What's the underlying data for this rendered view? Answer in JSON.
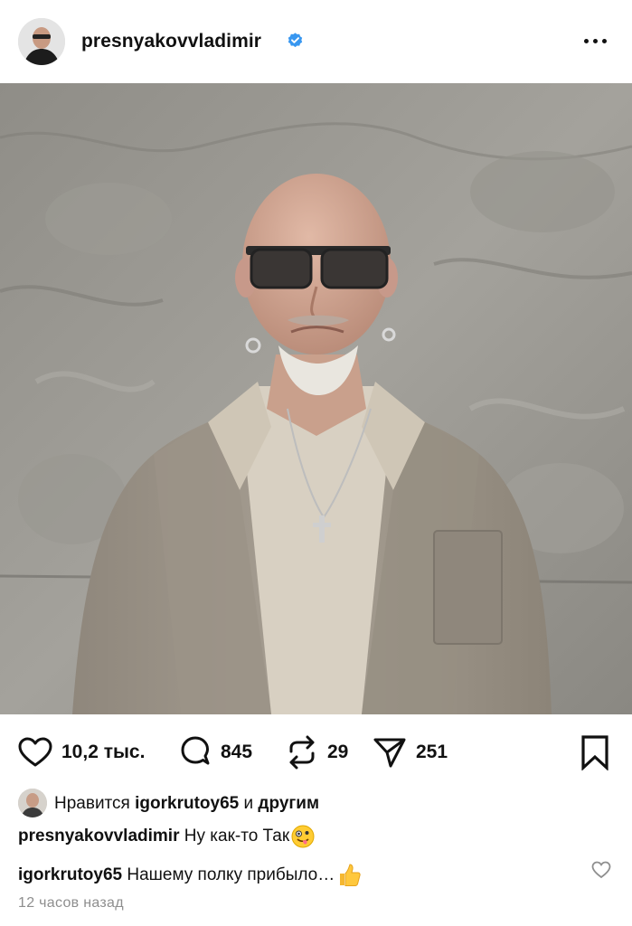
{
  "post": {
    "username": "presnyakovvladimir",
    "verified": true
  },
  "actions": {
    "likes": "10,2 тыс.",
    "comments": "845",
    "reposts": "29",
    "shares": "251"
  },
  "liked_by": {
    "prefix": "Нравится",
    "user": "igorkrutoy65",
    "conj": "и",
    "others": "другим"
  },
  "caption": {
    "user": "presnyakovvladimir",
    "text": "Ну как-то Так",
    "emoji": "zany-face-emoji"
  },
  "comment": {
    "user": "igorkrutoy65",
    "text": "Нашему полку прибыло…",
    "emoji": "thumbs-up-emoji"
  },
  "timestamp": "12 часов назад",
  "colors": {
    "verified_blue": "#3897f0",
    "muted_text": "#8e8e8e",
    "wall": "#8d8b85",
    "shirt": "#a59d90"
  },
  "icons": [
    "verified-badge-icon",
    "more-options-icon",
    "heart-icon",
    "comment-icon",
    "repost-icon",
    "share-icon",
    "bookmark-icon",
    "small-heart-icon"
  ]
}
